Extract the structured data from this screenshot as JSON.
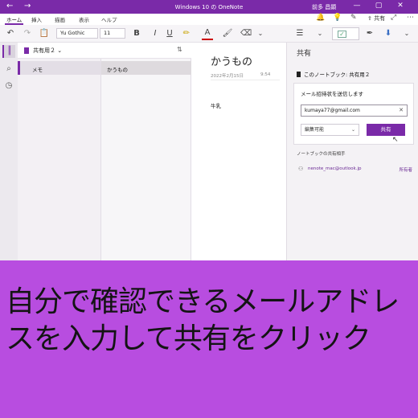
{
  "window": {
    "title": "Windows 10 の OneNote",
    "user": "前多 昌顕",
    "back_glyph": "←",
    "forward_glyph": "→",
    "controls": [
      "—",
      "▢",
      "✕"
    ]
  },
  "ribbon": {
    "tabs": [
      "ホーム",
      "挿入",
      "描画",
      "表示",
      "ヘルプ"
    ],
    "active_tab": "ホーム",
    "share_label": "共有"
  },
  "toolbar": {
    "font_name": "Yu Gothic",
    "font_size": "11",
    "bold": "B",
    "italic": "I",
    "underline": "U"
  },
  "notebook": {
    "name": "共有用２",
    "sections": [
      "メモ"
    ],
    "pages": [
      "かうもの"
    ]
  },
  "page": {
    "title": "かうもの",
    "date": "2022年2月15日",
    "time": "9:54",
    "body": "牛乳"
  },
  "share_pane": {
    "heading": "共有",
    "notebook_label": "このノートブック: 共有用２",
    "invite_label": "メール招待状を送信します",
    "email_value": "kumaya77@gmail.com",
    "permission": "編集可能",
    "share_button": "共有",
    "members_heading": "ノートブックの共有相手",
    "members": [
      {
        "email": "nenote_mac@outlook.jp",
        "role": "所有者"
      }
    ]
  },
  "caption": {
    "line1": "自分で確認できるメールアドレ",
    "line2": "スを入力して共有をクリック"
  },
  "colors": {
    "accent": "#7a2aa8",
    "caption_bg": "#b84de0"
  }
}
